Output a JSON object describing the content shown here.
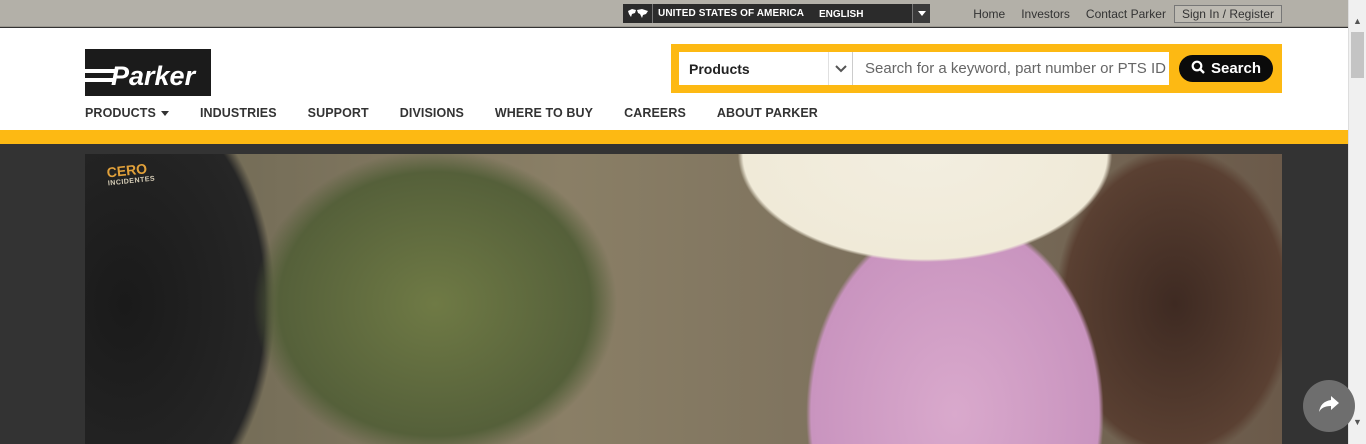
{
  "utility": {
    "country": "UNITED STATES OF AMERICA",
    "language": "ENGLISH",
    "links": [
      "Home",
      "Investors",
      "Contact Parker",
      "Sign In / Register"
    ]
  },
  "brand": {
    "name": "Parker",
    "accent": "#fdb913"
  },
  "search": {
    "category": "Products",
    "placeholder": "Search for a keyword, part number or PTS ID",
    "button": "Search"
  },
  "nav": {
    "items": [
      "PRODUCTS",
      "INDUSTRIES",
      "SUPPORT",
      "DIVISIONS",
      "WHERE TO BUY",
      "CAREERS",
      "ABOUT PARKER"
    ]
  },
  "hero": {
    "patch_title": "CERO",
    "patch_sub": "INCIDENTES"
  },
  "icons": [
    "globe-icon",
    "chevron-down-icon",
    "search-icon",
    "caret-down-icon",
    "share-icon"
  ]
}
